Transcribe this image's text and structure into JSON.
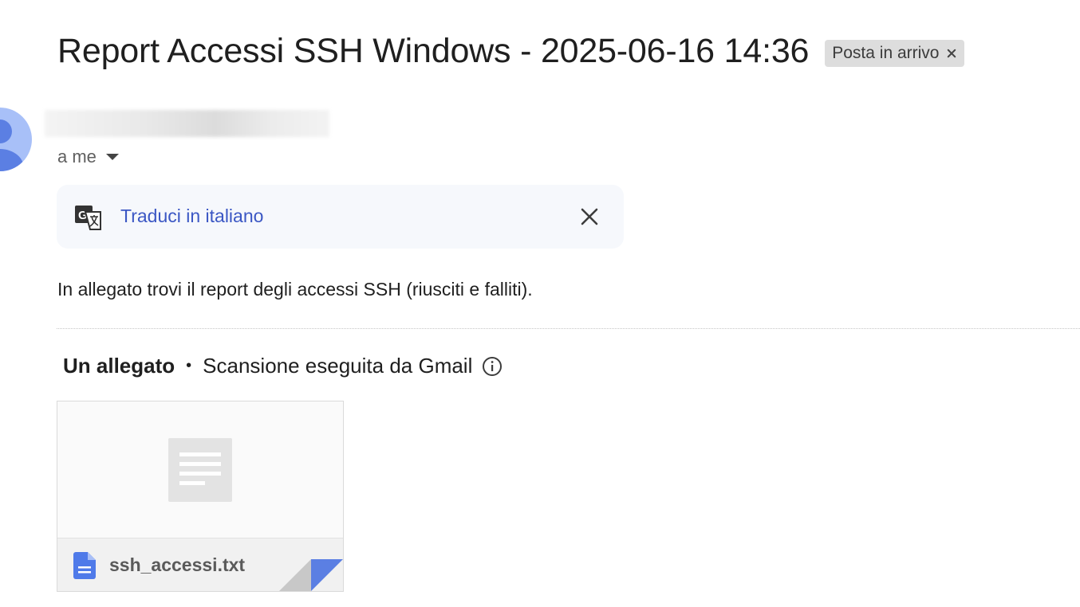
{
  "email": {
    "subject": "Report Accessi SSH Windows - 2025-06-16 14:36",
    "label": "Posta in arrivo",
    "recipient": "a me",
    "body": "In allegato trovi il report degli accessi SSH (riusciti e falliti)."
  },
  "translate_bar": {
    "link_label": "Traduci in italiano"
  },
  "attachments": {
    "count_label": "Un allegato",
    "separator": "•",
    "scan_label": "Scansione eseguita da Gmail",
    "items": [
      {
        "file_name": "ssh_accessi.txt"
      }
    ]
  },
  "colors": {
    "link_blue": "#3b57c4",
    "avatar_bg": "#a8c0f8",
    "avatar_fg": "#5b7fe3",
    "doc_icon_blue": "#4f7ae9"
  },
  "icons": {
    "label_remove": "close-icon",
    "recipient_details": "caret-down-icon",
    "translate": "translate-icon",
    "translate_dismiss": "close-icon",
    "scan_info": "info-icon",
    "file_type": "document-icon"
  }
}
